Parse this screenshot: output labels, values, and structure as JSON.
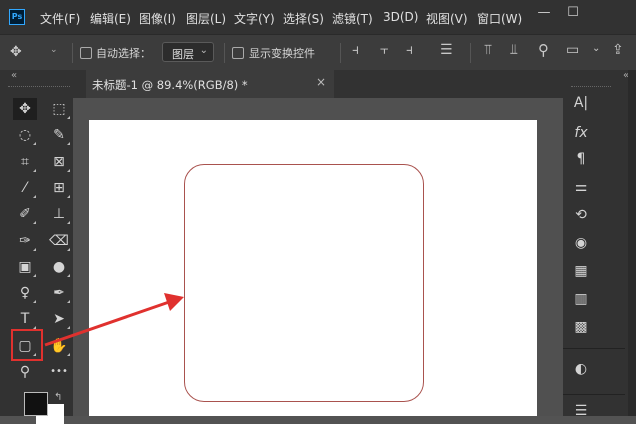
{
  "app": {
    "logo": "Ps"
  },
  "menu": [
    {
      "label": "文件(F)"
    },
    {
      "label": "编辑(E)"
    },
    {
      "label": "图像(I)"
    },
    {
      "label": "图层(L)"
    },
    {
      "label": "文字(Y)"
    },
    {
      "label": "选择(S)"
    },
    {
      "label": "滤镜(T)"
    },
    {
      "label": "3D(D)"
    },
    {
      "label": "视图(V)"
    },
    {
      "label": "窗口(W)"
    }
  ],
  "window_controls": {
    "minimize": "—",
    "maximize": "☐"
  },
  "options": {
    "auto_select_label": "自动选择：",
    "auto_select_value": "图层",
    "show_transform_label": "显示变换控件"
  },
  "panel_collapse": "«",
  "document_tab": {
    "title": "未标题-1 @ 89.4%(RGB/8) *",
    "close": "×"
  },
  "tools": [
    {
      "name": "move-tool-icon",
      "glyph": "✥"
    },
    {
      "name": "marquee-tool-icon",
      "glyph": "⬚"
    },
    {
      "name": "lasso-tool-icon",
      "glyph": "◌"
    },
    {
      "name": "quick-select-tool-icon",
      "glyph": "✎"
    },
    {
      "name": "crop-tool-icon",
      "glyph": "⌗"
    },
    {
      "name": "frame-tool-icon",
      "glyph": "⊠"
    },
    {
      "name": "eyedropper-tool-icon",
      "glyph": "⁄"
    },
    {
      "name": "healing-tool-icon",
      "glyph": "⊞"
    },
    {
      "name": "brush-tool-icon",
      "glyph": "✐"
    },
    {
      "name": "stamp-tool-icon",
      "glyph": "⊥"
    },
    {
      "name": "history-brush-tool-icon",
      "glyph": "✑"
    },
    {
      "name": "eraser-tool-icon",
      "glyph": "⌫"
    },
    {
      "name": "gradient-tool-icon",
      "glyph": "▣"
    },
    {
      "name": "blur-tool-icon",
      "glyph": "●"
    },
    {
      "name": "dodge-tool-icon",
      "glyph": "♀"
    },
    {
      "name": "pen-tool-icon",
      "glyph": "✒"
    },
    {
      "name": "type-tool-icon",
      "glyph": "T"
    },
    {
      "name": "path-select-tool-icon",
      "glyph": "➤"
    },
    {
      "name": "rectangle-tool-icon",
      "glyph": "▢"
    },
    {
      "name": "hand-tool-icon",
      "glyph": "✋"
    },
    {
      "name": "zoom-tool-icon",
      "glyph": "⚲"
    },
    {
      "name": "more-tools-icon",
      "glyph": "•••"
    }
  ],
  "right_panel_icons": [
    {
      "name": "character-panel-icon",
      "glyph": "A|"
    },
    {
      "name": "styles-panel-icon",
      "glyph": "fx"
    },
    {
      "name": "paragraph-panel-icon",
      "glyph": "¶"
    },
    {
      "name": "adjustments-panel-icon",
      "glyph": "⚌"
    },
    {
      "name": "history-panel-icon",
      "glyph": "⟲"
    },
    {
      "name": "color-panel-icon",
      "glyph": "◉"
    },
    {
      "name": "swatches-panel-icon",
      "glyph": "▦"
    },
    {
      "name": "gradients-panel-icon",
      "glyph": "▥"
    },
    {
      "name": "patterns-panel-icon",
      "glyph": "▩"
    },
    {
      "name": "adjust-layer-panel-icon",
      "glyph": "◐"
    },
    {
      "name": "properties-panel-icon",
      "glyph": "☰"
    }
  ],
  "colors": {
    "accent_highlight": "#e0312e",
    "shape_stroke": "#a9524e",
    "foreground": "#111111",
    "background": "#ffffff"
  }
}
